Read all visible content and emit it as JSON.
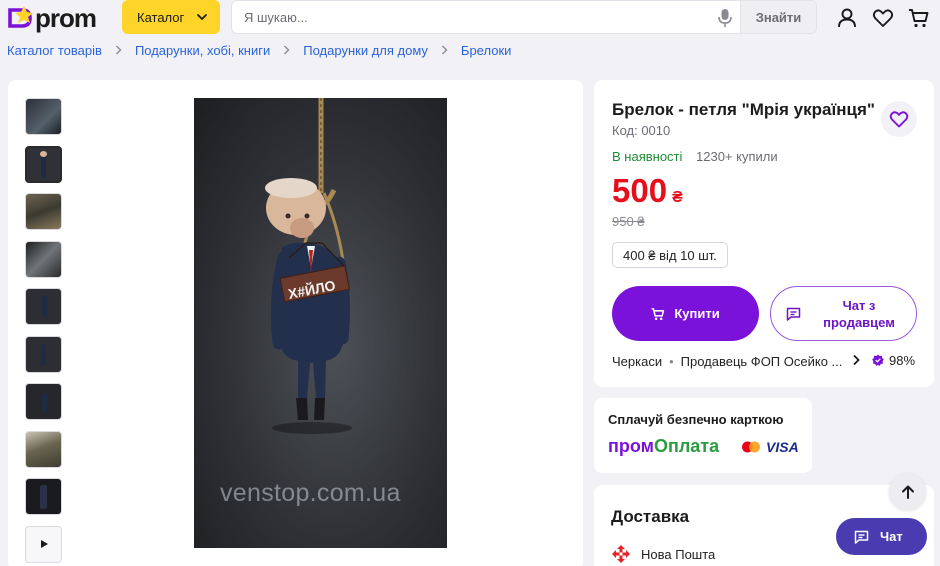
{
  "header": {
    "logo_text": "prom",
    "catalog_label": "Каталог",
    "search_placeholder": "Я шукаю...",
    "search_button": "Знайти"
  },
  "breadcrumb": [
    {
      "label": "Каталог товарів"
    },
    {
      "label": "Подарунки, хобі, книги"
    },
    {
      "label": "Подарунки для дому"
    },
    {
      "label": "Брелоки"
    }
  ],
  "gallery": {
    "thumb_count": 10,
    "active_index": 1,
    "watermark": "venstop.com.ua",
    "sign_text": "Х#ЙЛО"
  },
  "product": {
    "title": "Брелок - петля \"Мрія українця\"",
    "code": "Код: 0010",
    "stock": "В наявності",
    "bought": "1230+ купили",
    "price": "500",
    "currency": "₴",
    "old_price": "950 ₴",
    "wholesale": "400 ₴ від 10 шт.",
    "buy_label": "Купити",
    "chat_label": "Чат з продавцем",
    "city": "Черкаси",
    "seller": "Продавець ФОП Осейко ...",
    "rating": "98%"
  },
  "payment": {
    "title": "Сплачуй безпечно карткою",
    "logo_part1": "пром",
    "logo_part2": "Оплата",
    "visa": "VISA"
  },
  "delivery": {
    "title": "Доставка",
    "carrier": "Нова Пошта"
  },
  "floating": {
    "chat_label": "Чат"
  },
  "colors": {
    "brand_purple": "#7b12d9",
    "catalog_yellow": "#ffd428",
    "price_red": "#e6101d",
    "stock_green": "#1d8b37",
    "link_blue": "#2b63d9"
  }
}
